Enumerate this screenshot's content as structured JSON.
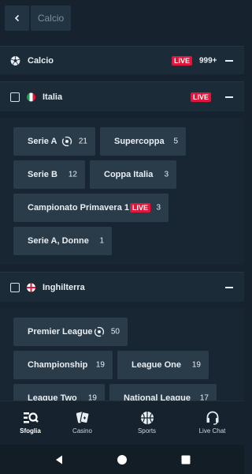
{
  "topbar": {
    "back_icon": "chevron-left-icon",
    "breadcrumb": "Calcio"
  },
  "sport": {
    "title": "Calcio",
    "live": "LIVE",
    "count": "999+",
    "icon": "soccer-ball-icon"
  },
  "italia": {
    "title": "Italia",
    "live": "LIVE",
    "leagues": [
      {
        "label": "Serie A",
        "count": "21",
        "has_live_icon": true
      },
      {
        "label": "Supercoppa",
        "count": "5"
      },
      {
        "label": "Serie B",
        "count": "12"
      },
      {
        "label": "Coppa Italia",
        "count": "3"
      },
      {
        "label": "Campionato Primavera 1",
        "count": "3",
        "live": "LIVE"
      },
      {
        "label": "Serie A, Donne",
        "count": "1"
      }
    ]
  },
  "inghilterra": {
    "title": "Inghilterra",
    "leagues": [
      {
        "label": "Premier League",
        "count": "50",
        "has_live_icon": true
      },
      {
        "label": "Championship",
        "count": "19"
      },
      {
        "label": "League One",
        "count": "19"
      },
      {
        "label": "League Two",
        "count": "19"
      },
      {
        "label": "National League",
        "count": "17"
      }
    ]
  },
  "bottom_nav": [
    {
      "label": "Sfoglia",
      "icon": "browse-icon",
      "active": true
    },
    {
      "label": "Casino",
      "icon": "cards-icon"
    },
    {
      "label": "Sports",
      "icon": "basketball-icon"
    },
    {
      "label": "Live Chat",
      "icon": "headset-icon"
    }
  ],
  "colors": {
    "live": "#e0173c",
    "background": "#16232f",
    "chip": "#2a3b49"
  }
}
